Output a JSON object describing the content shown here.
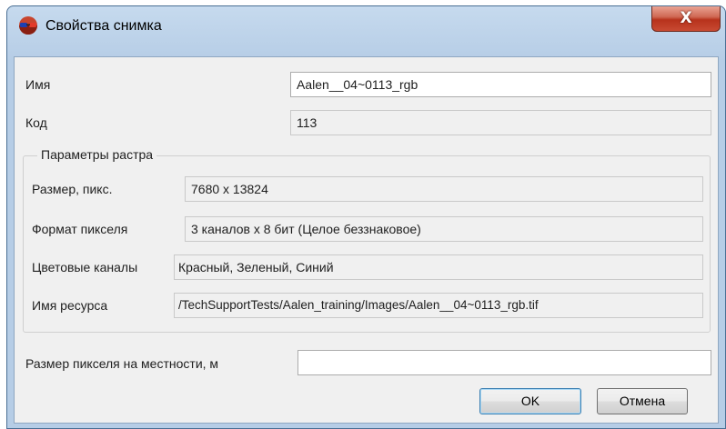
{
  "window": {
    "title": "Свойства снимка",
    "close_label": "X"
  },
  "fields": {
    "name": {
      "label": "Имя",
      "value": "Aalen__04~0113_rgb"
    },
    "code": {
      "label": "Код",
      "value": "113"
    }
  },
  "raster_group": {
    "title": "Параметры растра",
    "size": {
      "label": "Размер, пикс.",
      "value": "7680 x 13824"
    },
    "pixel_format": {
      "label": "Формат пикселя",
      "value": "3 каналов x 8 бит (Целое беззнаковое)"
    },
    "channels": {
      "label": "Цветовые каналы",
      "value": "Красный, Зеленый, Синий"
    },
    "resource": {
      "label": "Имя ресурса",
      "value": "/TechSupportTests/Aalen_training/Images/Aalen__04~0113_rgb.tif"
    }
  },
  "ground_pixel": {
    "label": "Размер пикселя на местности, м",
    "value": ""
  },
  "buttons": {
    "ok": "OK",
    "cancel": "Отмена"
  }
}
